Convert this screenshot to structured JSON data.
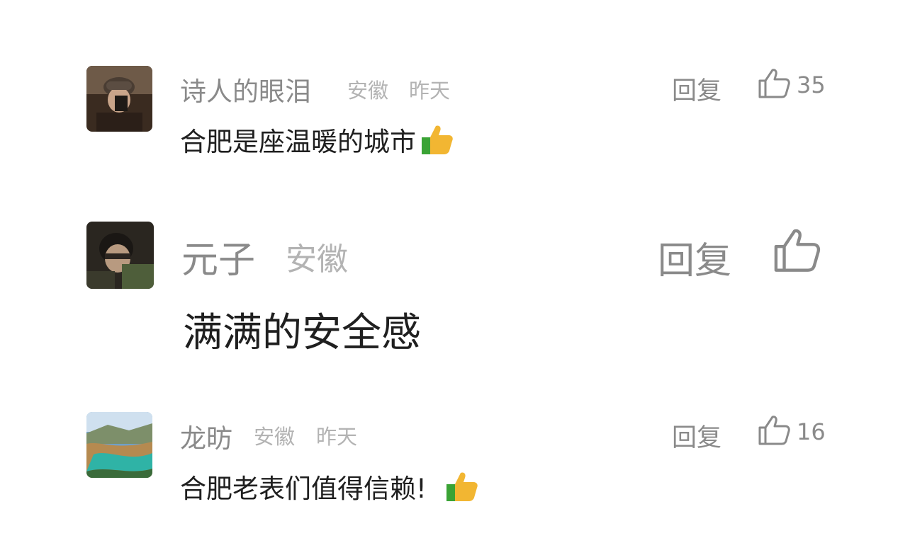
{
  "comments": [
    {
      "username": "诗人的眼泪",
      "location": "安徽",
      "time": "昨天",
      "reply_label": "回复",
      "like_count": "35",
      "text": "合肥是座温暖的城市",
      "emoji": "thumbs-up-emoji"
    },
    {
      "username": "元子",
      "location": "安徽",
      "time": "",
      "reply_label": "回复",
      "like_count": "",
      "text": "满满的安全感",
      "emoji": ""
    },
    {
      "username": "龙昉",
      "location": "安徽",
      "time": "昨天",
      "reply_label": "回复",
      "like_count": "16",
      "text": "合肥老表们值得信赖!",
      "emoji": "thumbs-up-emoji"
    }
  ],
  "colors": {
    "username": "#8a8a8a",
    "meta": "#b3b3b3",
    "text": "#1f1f1f",
    "background": "#ffffff"
  }
}
